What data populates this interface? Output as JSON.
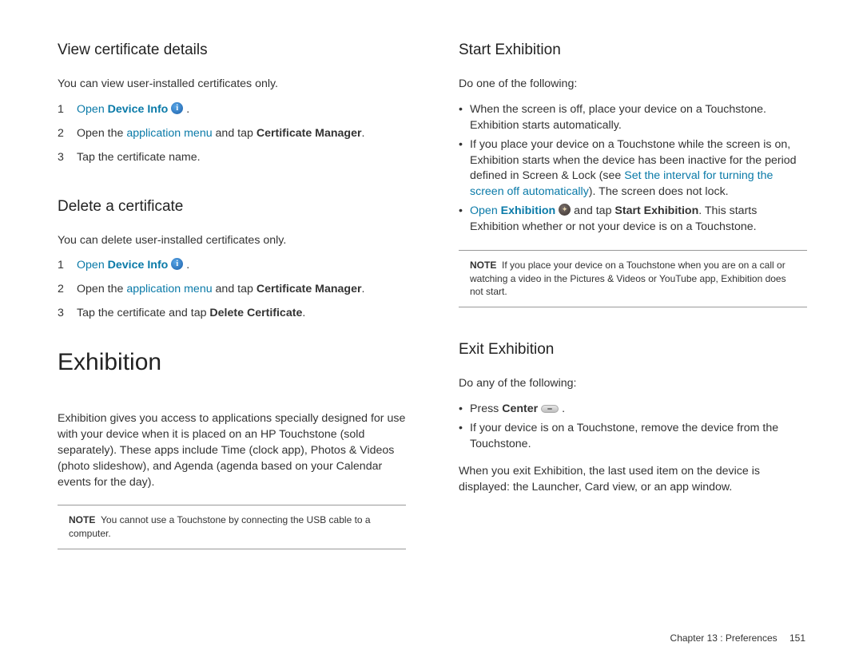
{
  "left": {
    "section1": {
      "heading": "View certificate details",
      "intro": "You can view user-installed certificates only.",
      "steps": [
        {
          "n": "1",
          "pre": "Open ",
          "bold": "Device Info",
          "icon": "info",
          "post": " ."
        },
        {
          "n": "2",
          "pre": "Open the ",
          "link": "application menu",
          "mid": " and tap ",
          "bold": "Certificate Manager",
          "post": "."
        },
        {
          "n": "3",
          "pre": "Tap the certificate name."
        }
      ]
    },
    "section2": {
      "heading": "Delete a certificate",
      "intro": "You can delete user-installed certificates only.",
      "steps": [
        {
          "n": "1",
          "pre": "Open ",
          "bold": "Device Info",
          "icon": "info",
          "post": " ."
        },
        {
          "n": "2",
          "pre": "Open the ",
          "link": "application menu",
          "mid": " and tap ",
          "bold": "Certificate Manager",
          "post": "."
        },
        {
          "n": "3",
          "pre": "Tap the certificate and tap ",
          "bold": "Delete Certificate",
          "post": "."
        }
      ]
    },
    "exhibition": {
      "heading": "Exhibition",
      "para": "Exhibition gives you access to applications specially designed for use with your device when it is placed on an HP Touchstone (sold separately). These apps include Time (clock app), Photos & Videos (photo slideshow), and Agenda (agenda based on your Calendar events for the day).",
      "note_label": "NOTE",
      "note": "You cannot use a Touchstone by connecting the USB cable to a computer."
    }
  },
  "right": {
    "section1": {
      "heading": "Start Exhibition",
      "intro": "Do one of the following:",
      "bullets": {
        "b1": "When the screen is off, place your device on a Touchstone. Exhibition starts automatically.",
        "b2_pre": "If you place your device on a Touchstone while the screen is on, Exhibition starts when the device has been inactive for the period defined in Screen & Lock (see ",
        "b2_link": "Set the interval for turning the screen off automatically",
        "b2_post": "). The screen does not lock.",
        "b3_link": "Open ",
        "b3_bold1": "Exhibition",
        "b3_mid": " and tap ",
        "b3_bold2": "Start Exhibition",
        "b3_post": ". This starts Exhibition whether or not your device is on a Touchstone."
      },
      "note_label": "NOTE",
      "note": "If you place your device on a Touchstone when you are on a call or watching a video in the Pictures & Videos or YouTube app, Exhibition does not start."
    },
    "section2": {
      "heading": "Exit Exhibition",
      "intro": "Do any of the following:",
      "bullets": {
        "b1_pre": "Press ",
        "b1_bold": "Center",
        "b1_post": " .",
        "b2": "If your device is on a Touchstone, remove the device from the Touchstone."
      },
      "outro": "When you exit Exhibition, the last used item on the device is displayed: the Launcher, Card view, or an app window."
    }
  },
  "footer": {
    "chapter": "Chapter 13 : Preferences",
    "page": "151"
  }
}
